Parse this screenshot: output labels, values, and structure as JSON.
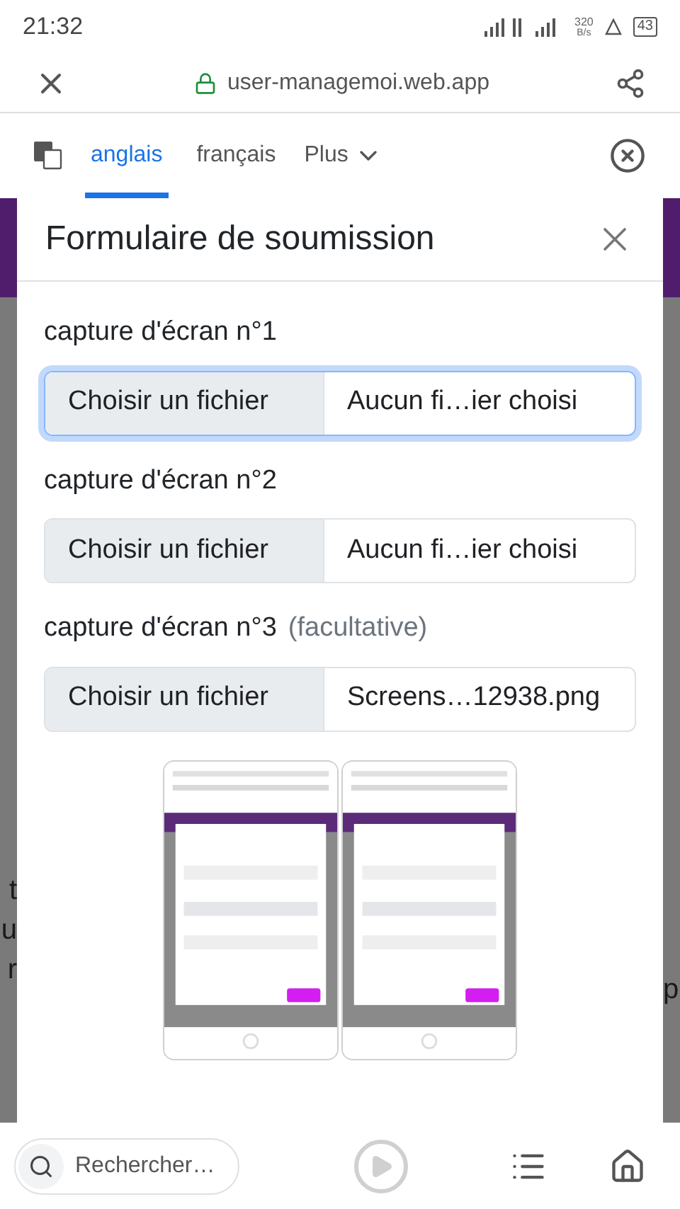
{
  "status_bar": {
    "time": "21:32",
    "speed_value": "320",
    "speed_unit": "B/s",
    "battery": "43"
  },
  "browser_bar": {
    "url": "user-managemoi.web.app"
  },
  "translate_bar": {
    "languages": [
      {
        "label": "anglais",
        "selected": true
      },
      {
        "label": "français",
        "selected": false
      }
    ],
    "more": "Plus"
  },
  "background_page": {
    "left_fragments": [
      "t",
      "u",
      "r"
    ],
    "right_fragments": [
      "p"
    ]
  },
  "modal": {
    "title": "Formulaire de soumission",
    "fields": [
      {
        "label": "capture d'écran n°1",
        "button": "Choisir un fichier",
        "file": "Aucun fi…ier choisi",
        "focused": true
      },
      {
        "label": "capture d'écran n°2",
        "button": "Choisir un fichier",
        "file": "Aucun fi…ier choisi",
        "focused": false
      },
      {
        "label": "capture d'écran n°3",
        "optional": "(facultative)",
        "button": "Choisir un fichier",
        "file": "Screens…12938.png",
        "focused": false
      }
    ]
  },
  "bottom_bar": {
    "search_placeholder": "Rechercher…"
  }
}
